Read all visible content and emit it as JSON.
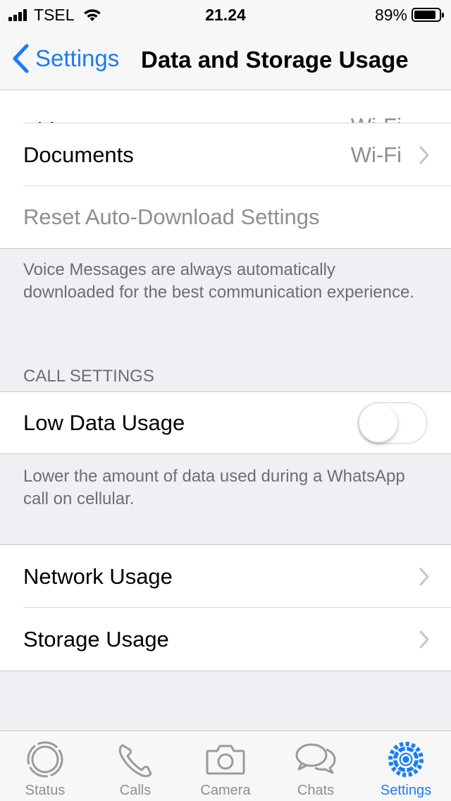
{
  "status_bar": {
    "carrier": "TSEL",
    "time": "21.24",
    "battery_percent_label": "89%",
    "battery_level": 0.89,
    "icons": [
      "signal-icon",
      "wifi-icon",
      "battery-icon"
    ]
  },
  "nav": {
    "back_label": "Settings",
    "title": "Data and Storage Usage"
  },
  "auto_download": {
    "rows": [
      {
        "label": "Videos",
        "value": "Wi-Fi"
      },
      {
        "label": "Documents",
        "value": "Wi-Fi"
      }
    ],
    "reset_label": "Reset Auto-Download Settings",
    "footnote": "Voice Messages are always automatically downloaded for the best communication experience."
  },
  "call_settings": {
    "header": "CALL SETTINGS",
    "low_data_label": "Low Data Usage",
    "low_data_enabled": false,
    "footnote": "Lower the amount of data used during a WhatsApp call on cellular."
  },
  "usage": {
    "network_label": "Network Usage",
    "storage_label": "Storage Usage"
  },
  "tab_bar": {
    "tabs": [
      {
        "label": "Status",
        "icon": "status-icon",
        "active": false
      },
      {
        "label": "Calls",
        "icon": "phone-icon",
        "active": false
      },
      {
        "label": "Camera",
        "icon": "camera-icon",
        "active": false
      },
      {
        "label": "Chats",
        "icon": "chat-bubbles-icon",
        "active": false
      },
      {
        "label": "Settings",
        "icon": "gear-icon",
        "active": true
      }
    ]
  },
  "colors": {
    "accent": "#1a7cf5",
    "secondary_text": "#8e8e93",
    "grouped_background": "#efeff4"
  }
}
